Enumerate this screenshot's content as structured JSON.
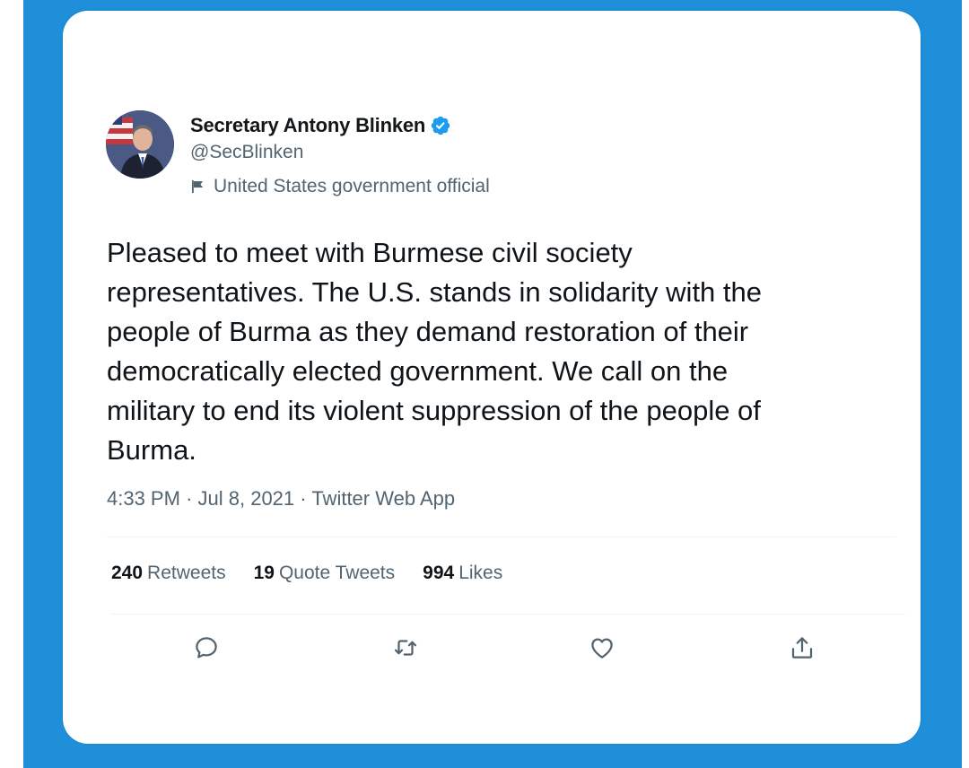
{
  "tweet": {
    "author": {
      "display_name": "Secretary Antony Blinken",
      "handle": "@SecBlinken",
      "label": "United States government official",
      "verified": true
    },
    "text": "Pleased to meet with Burmese civil society\nrepresentatives. The U.S. stands in solidarity with the\npeople of Burma as they demand restoration of their\ndemocratically elected government. We call on the\nmilitary to end its violent suppression of the people of\nBurma.",
    "meta": {
      "time": "4:33 PM",
      "date": "Jul 8, 2021",
      "source": "Twitter Web App",
      "separator": "·"
    },
    "stats": {
      "retweets_count": "240",
      "retweets_label": "Retweets",
      "quotes_count": "19",
      "quotes_label": "Quote Tweets",
      "likes_count": "994",
      "likes_label": "Likes"
    },
    "actions": [
      {
        "icon": "reply-icon"
      },
      {
        "icon": "retweet-icon"
      },
      {
        "icon": "like-icon"
      },
      {
        "icon": "share-icon"
      }
    ]
  },
  "colors": {
    "frame": "#1f8fd9",
    "verified": "#1d9bf0",
    "text_primary": "#0f1419",
    "text_secondary": "#536471"
  }
}
